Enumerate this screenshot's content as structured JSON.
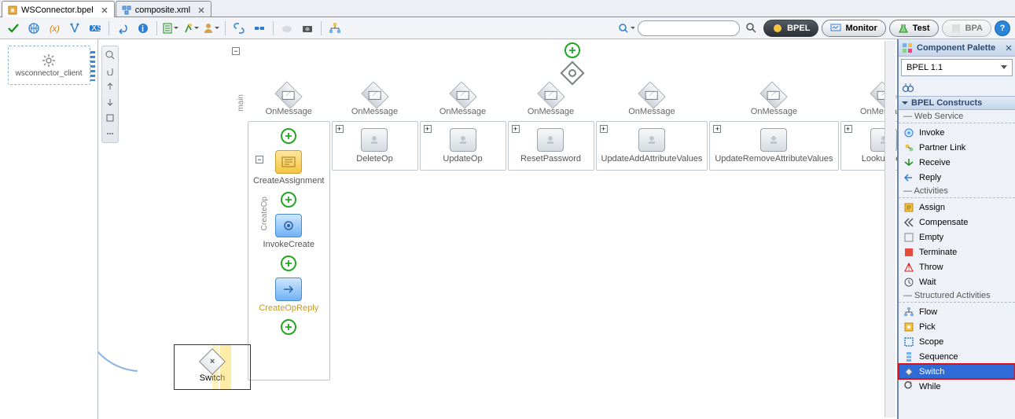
{
  "tabs": [
    {
      "label": "WSConnector.bpel",
      "active": true
    },
    {
      "label": "composite.xml",
      "active": false
    }
  ],
  "left_client_label": "wsconnector_client",
  "view_buttons": {
    "bpel": "BPEL",
    "monitor": "Monitor",
    "test": "Test",
    "bpa": "BPA"
  },
  "canvas": {
    "main_label": "main",
    "createop_label": "CreateOp",
    "head_label": "OnMessage",
    "lane0": {
      "assign_label": "CreateAssignment",
      "invoke_label": "InvokeCreate",
      "reply_label": "CreateOpReply"
    },
    "lanes_rest": [
      {
        "label": "DeleteOp"
      },
      {
        "label": "UpdateOp"
      },
      {
        "label": "ResetPassword"
      },
      {
        "label": "UpdateAddAttributeValues"
      },
      {
        "label": "UpdateRemoveAttributeValues"
      },
      {
        "label": "LookupSea"
      }
    ],
    "drag_ghost_label": "Switch"
  },
  "palette": {
    "title": "Component Palette",
    "selector": "BPEL 1.1",
    "section": "BPEL Constructs",
    "groups": [
      {
        "label": "Web Service",
        "items": [
          {
            "label": "Invoke",
            "icon": "invoke"
          },
          {
            "label": "Partner Link",
            "icon": "partner"
          },
          {
            "label": "Receive",
            "icon": "receive"
          },
          {
            "label": "Reply",
            "icon": "reply"
          }
        ]
      },
      {
        "label": "Activities",
        "items": [
          {
            "label": "Assign",
            "icon": "assign"
          },
          {
            "label": "Compensate",
            "icon": "compensate"
          },
          {
            "label": "Empty",
            "icon": "empty"
          },
          {
            "label": "Terminate",
            "icon": "terminate"
          },
          {
            "label": "Throw",
            "icon": "throw"
          },
          {
            "label": "Wait",
            "icon": "wait"
          }
        ]
      },
      {
        "label": "Structured Activities",
        "items": [
          {
            "label": "Flow",
            "icon": "flow"
          },
          {
            "label": "Pick",
            "icon": "pick"
          },
          {
            "label": "Scope",
            "icon": "scope"
          },
          {
            "label": "Sequence",
            "icon": "sequence"
          },
          {
            "label": "Switch",
            "icon": "switch",
            "selected": true
          },
          {
            "label": "While",
            "icon": "while"
          }
        ]
      }
    ]
  }
}
